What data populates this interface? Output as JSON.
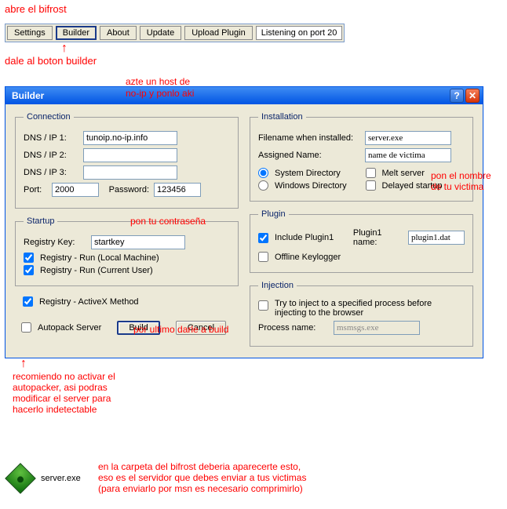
{
  "annotations": {
    "open": "abre el bifrost",
    "builder_hint": "dale al boton builder",
    "host_hint_l1": "azte un host de",
    "host_hint_l2": "no-ip y ponlo aki",
    "password_hint": "pon tu contraseña",
    "name_hint_l1": "pon el nombre",
    "name_hint_l2": "de tu victima",
    "build_hint": "por ultimo darle a build",
    "autopack_l1": "recomiendo no activar el",
    "autopack_l2": "autopacker, asi podras",
    "autopack_l3": "modificar el server para",
    "autopack_l4": "hacerlo indetectable",
    "server_l1": "en la carpeta del bifrost deberia aparecerte esto,",
    "server_l2": "eso es el servidor que debes enviar a tus victimas",
    "server_l3": "(para enviarlo por msn es necesario comprimirlo)"
  },
  "toolbar": {
    "settings": "Settings",
    "builder": "Builder",
    "about": "About",
    "update": "Update",
    "upload": "Upload Plugin",
    "status": "Listening on port 20"
  },
  "window": {
    "title": "Builder"
  },
  "connection": {
    "legend": "Connection",
    "dns1_label": "DNS / IP 1:",
    "dns1_value": "tunoip.no-ip.info",
    "dns2_label": "DNS / IP 2:",
    "dns2_value": "",
    "dns3_label": "DNS / IP 3:",
    "dns3_value": "",
    "port_label": "Port:",
    "port_value": "2000",
    "password_label": "Password:",
    "password_value": "123456"
  },
  "startup": {
    "legend": "Startup",
    "regkey_label": "Registry Key:",
    "regkey_value": "startkey",
    "run_lm": "Registry - Run (Local Machine)",
    "run_cu": "Registry - Run (Current User)",
    "activex": "Registry - ActiveX Method"
  },
  "build_area": {
    "autopack": "Autopack Server",
    "build": "Build",
    "cancel": "Cancel"
  },
  "installation": {
    "legend": "Installation",
    "filename_label": "Filename when installed:",
    "filename_value": "server.exe",
    "assigned_label": "Assigned Name:",
    "assigned_value": "name de victima",
    "sysdir": "System Directory",
    "windir": "Windows Directory",
    "melt": "Melt server",
    "delayed": "Delayed startup"
  },
  "plugin": {
    "legend": "Plugin",
    "include": "Include Plugin1",
    "name_label": "Plugin1 name:",
    "name_value": "plugin1.dat",
    "offline": "Offline Keylogger"
  },
  "injection": {
    "legend": "Injection",
    "try": "Try to inject to a specified process before injecting to the browser",
    "process_label": "Process name:",
    "process_value": "msmsgs.exe"
  },
  "server_file": "server.exe"
}
